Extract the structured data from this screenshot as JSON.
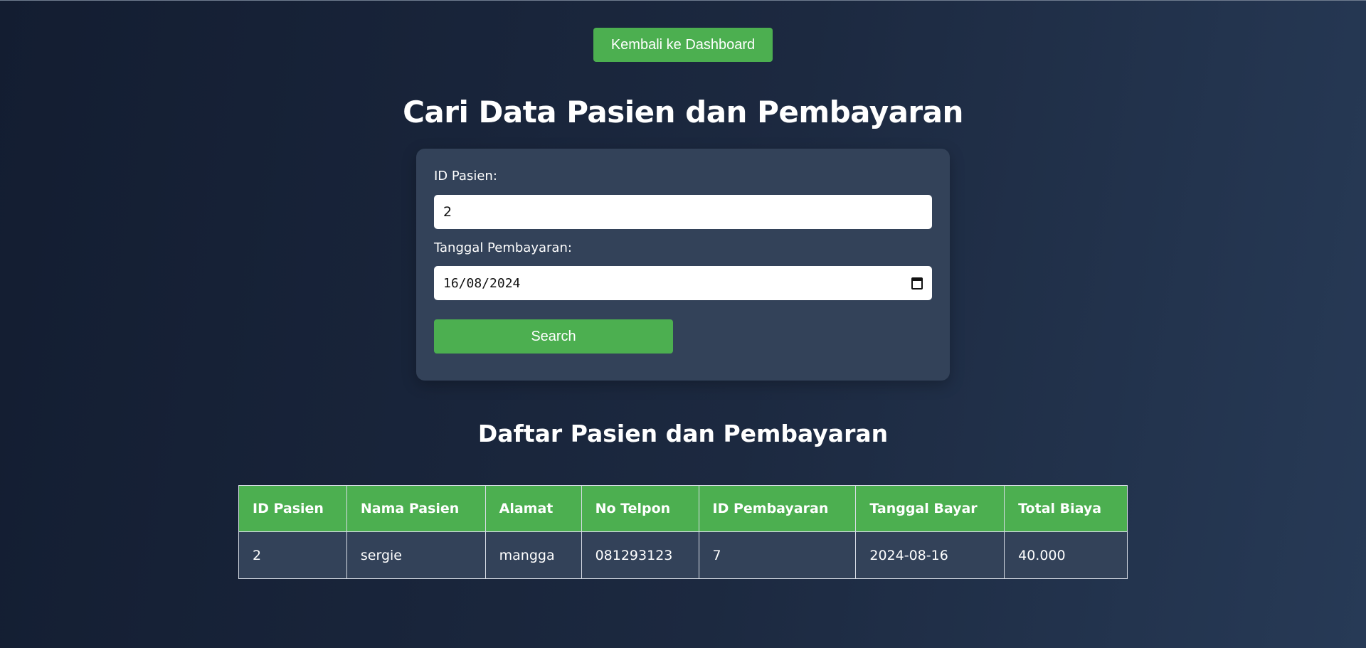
{
  "nav": {
    "back_label": "Kembali ke Dashboard"
  },
  "page": {
    "title": "Cari Data Pasien dan Pembayaran"
  },
  "search_form": {
    "id_label": "ID Pasien:",
    "id_value": "2",
    "date_label": "Tanggal Pembayaran:",
    "date_value": "16/08/2024",
    "date_icon": "calendar-icon",
    "submit_label": "Search"
  },
  "results": {
    "title": "Daftar Pasien dan Pembayaran",
    "columns": [
      "ID Pasien",
      "Nama Pasien",
      "Alamat",
      "No Telpon",
      "ID Pembayaran",
      "Tanggal Bayar",
      "Total Biaya"
    ],
    "rows": [
      [
        "2",
        "sergie",
        "mangga",
        "081293123",
        "7",
        "2024-08-16",
        "40.000"
      ]
    ]
  },
  "colors": {
    "accent": "#4caf50",
    "card": "#334259",
    "background_start": "#131d31",
    "background_end": "#273a56"
  }
}
